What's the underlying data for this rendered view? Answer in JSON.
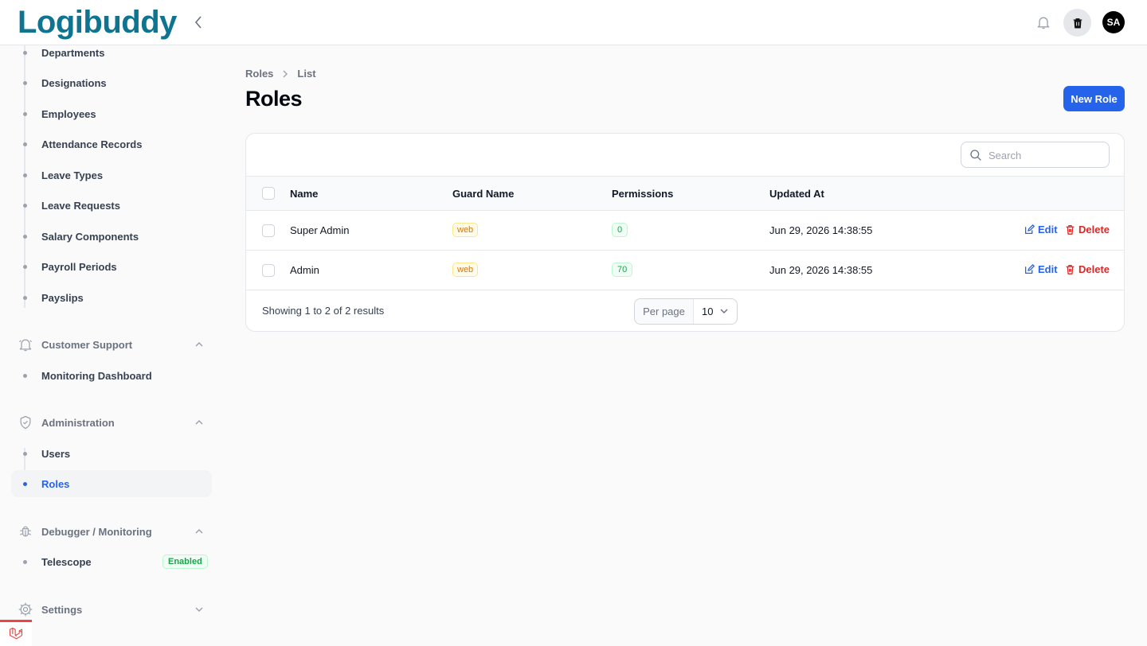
{
  "app": {
    "logo_text_a": "Logi",
    "logo_text_b": "buddy"
  },
  "header": {
    "avatar_initials": "SA"
  },
  "sidebar": {
    "hr_items": [
      {
        "label": "Departments"
      },
      {
        "label": "Designations"
      },
      {
        "label": "Employees"
      },
      {
        "label": "Attendance Records"
      },
      {
        "label": "Leave Types"
      },
      {
        "label": "Leave Requests"
      },
      {
        "label": "Salary Components"
      },
      {
        "label": "Payroll Periods"
      },
      {
        "label": "Payslips"
      }
    ],
    "groups": {
      "customer_support": {
        "label": "Customer Support",
        "items": [
          {
            "label": "Monitoring Dashboard"
          }
        ]
      },
      "administration": {
        "label": "Administration",
        "items": [
          {
            "label": "Users"
          },
          {
            "label": "Roles"
          }
        ]
      },
      "debugger": {
        "label": "Debugger / Monitoring",
        "items": [
          {
            "label": "Telescope",
            "badge": "Enabled"
          }
        ]
      },
      "settings": {
        "label": "Settings"
      }
    }
  },
  "breadcrumb": {
    "root": "Roles",
    "current": "List"
  },
  "page": {
    "title": "Roles",
    "new_button": "New Role"
  },
  "table": {
    "search_placeholder": "Search",
    "columns": {
      "name": "Name",
      "guard": "Guard Name",
      "permissions": "Permissions",
      "updated": "Updated At"
    },
    "rows": [
      {
        "name": "Super Admin",
        "guard": "web",
        "permissions": "0",
        "updated": "Jun 29, 2026 14:38:55"
      },
      {
        "name": "Admin",
        "guard": "web",
        "permissions": "70",
        "updated": "Jun 29, 2026 14:38:55"
      }
    ],
    "actions": {
      "edit": "Edit",
      "delete": "Delete"
    },
    "footer": {
      "summary": "Showing 1 to 2 of 2 results",
      "per_page_label": "Per page",
      "per_page_value": "10"
    }
  },
  "colors": {
    "primary": "#2563eb",
    "danger": "#dc2626",
    "logo": "#0e7490",
    "logo_accent": "#e11d48"
  }
}
